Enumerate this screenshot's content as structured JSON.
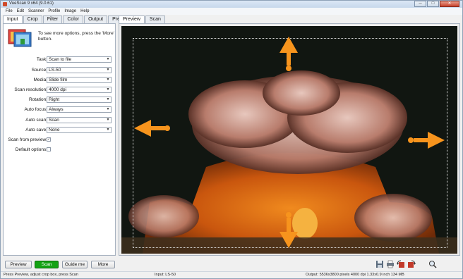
{
  "window": {
    "title": "VueScan 9 x64 (9.0.61)",
    "min_label": "─",
    "max_label": "□",
    "close_label": "✕"
  },
  "menu": [
    "File",
    "Edit",
    "Scanner",
    "Profile",
    "Image",
    "Help"
  ],
  "left_tabs": [
    "Input",
    "Crop",
    "Filter",
    "Color",
    "Output",
    "Prefs"
  ],
  "info_text": "To see more options, press the 'More' button.",
  "fields": {
    "task": {
      "label": "Task:",
      "value": "Scan to file"
    },
    "source": {
      "label": "Source:",
      "value": "LS-50"
    },
    "media": {
      "label": "Media:",
      "value": "Slide film"
    },
    "scan_resolution": {
      "label": "Scan resolution:",
      "value": "4000 dpi"
    },
    "rotation": {
      "label": "Rotation:",
      "value": "Right"
    },
    "auto_focus": {
      "label": "Auto focus:",
      "value": "Always"
    },
    "auto_scan": {
      "label": "Auto scan:",
      "value": "Scan"
    },
    "auto_save": {
      "label": "Auto save:",
      "value": "None"
    },
    "scan_from_preview": {
      "label": "Scan from preview:",
      "checked": true
    },
    "default_options": {
      "label": "Default options:",
      "checked": false
    }
  },
  "preview_tabs": [
    "Preview",
    "Scan"
  ],
  "buttons": {
    "preview": "Preview",
    "scan": "Scan",
    "guide": "Guide me",
    "more": "More"
  },
  "icons": [
    "save-icon",
    "print-icon",
    "rotate-left-icon",
    "rotate-right-icon",
    "zoom-icon"
  ],
  "status": {
    "left": "Press Preview, adjust crop box, press Scan",
    "middle": "Input: LS-50",
    "right": "Output: 5536x3800 pixels 4000 dpi 1.33x0.9 inch 134 MB"
  },
  "colors": {
    "accent_orange": "#f7941d",
    "scan_green": "#13a213"
  }
}
